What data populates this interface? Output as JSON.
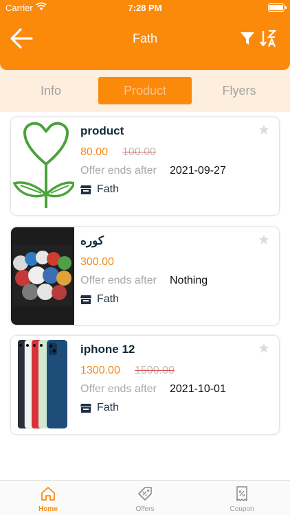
{
  "status_bar": {
    "carrier": "Carrier",
    "time": "7:28 PM"
  },
  "header": {
    "title": "Fath",
    "back_icon": "arrow-left-icon",
    "filter_icon": "filter-icon",
    "sort_icon": "sort-z-a-icon"
  },
  "segments": [
    {
      "label": "Info",
      "active": false
    },
    {
      "label": "Product",
      "active": true
    },
    {
      "label": "Flyers",
      "active": false
    }
  ],
  "products": [
    {
      "name": "product",
      "price": "80.00",
      "old_price": "100.00",
      "offer_label": "Offer ends after",
      "offer_value": "2021-09-27",
      "store": "Fath",
      "image": "heart-flower-drawing"
    },
    {
      "name": "كوره",
      "price": "300.00",
      "old_price": "",
      "offer_label": "Offer ends after",
      "offer_value": "Nothing",
      "store": "Fath",
      "image": "football-photo"
    },
    {
      "name": "iphone 12",
      "price": "1300.00",
      "old_price": "1500.00",
      "offer_label": "Offer ends after",
      "offer_value": "2021-10-01",
      "store": "Fath",
      "image": "iphone-colors-photo"
    }
  ],
  "tabs": [
    {
      "label": "Home",
      "icon": "home-icon",
      "active": true
    },
    {
      "label": "Offers",
      "icon": "offers-tag-icon",
      "active": false
    },
    {
      "label": "Coupon",
      "icon": "coupon-icon",
      "active": false
    }
  ],
  "colors": {
    "accent": "#fb8a0b",
    "segment_bg": "#fdeedd",
    "price": "#f2891a"
  }
}
